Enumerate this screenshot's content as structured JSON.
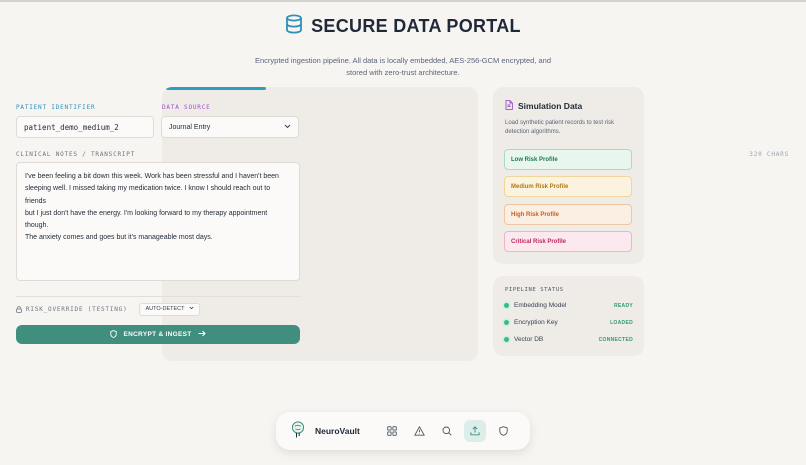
{
  "header": {
    "title": "SECURE DATA PORTAL",
    "subtitle": "Encrypted ingestion pipeline. All data is locally embedded, AES-256-GCM encrypted, and stored with zero-trust architecture."
  },
  "form": {
    "patient_label": "PATIENT IDENTIFIER",
    "patient_value": "patient_demo_medium_2",
    "source_label": "DATA SOURCE",
    "source_value": "Journal Entry",
    "notes_label": "CLINICAL NOTES / TRANSCRIPT",
    "char_count": "320 CHARS",
    "notes_text": "I've been feeling a bit down this week. Work has been stressful and I haven't been\nsleeping well. I missed taking my medication twice. I know I should reach out to friends\nbut I just don't have the energy. I'm looking forward to my therapy appointment though.\nThe anxiety comes and goes but it's manageable most days.",
    "risk_override_label": "RISK_OVERRIDE (TESTING)",
    "risk_override_value": "AUTO-DETECT",
    "submit_label": "ENCRYPT & INGEST"
  },
  "simulation": {
    "title": "Simulation Data",
    "description": "Load synthetic patient records to test risk detection algorithms.",
    "profiles": [
      {
        "label": "Low Risk Profile"
      },
      {
        "label": "Medium Risk Profile"
      },
      {
        "label": "High Risk Profile"
      },
      {
        "label": "Critical Risk Profile"
      }
    ]
  },
  "pipeline": {
    "title": "PIPELINE STATUS",
    "items": [
      {
        "name": "Embedding Model",
        "status": "READY"
      },
      {
        "name": "Encryption Key",
        "status": "LOADED"
      },
      {
        "name": "Vector DB",
        "status": "CONNECTED"
      }
    ]
  },
  "nav": {
    "brand": "NeuroVault",
    "icons": [
      "dashboard-icon",
      "alert-icon",
      "search-icon",
      "upload-icon",
      "shield-icon"
    ],
    "active": "upload-icon"
  },
  "colors": {
    "accent": "#3f8e7e",
    "progress": "#2f9fbf",
    "low": "#1c7a4f",
    "medium": "#b07a10",
    "high": "#c8611c",
    "critical": "#c12a5e"
  }
}
